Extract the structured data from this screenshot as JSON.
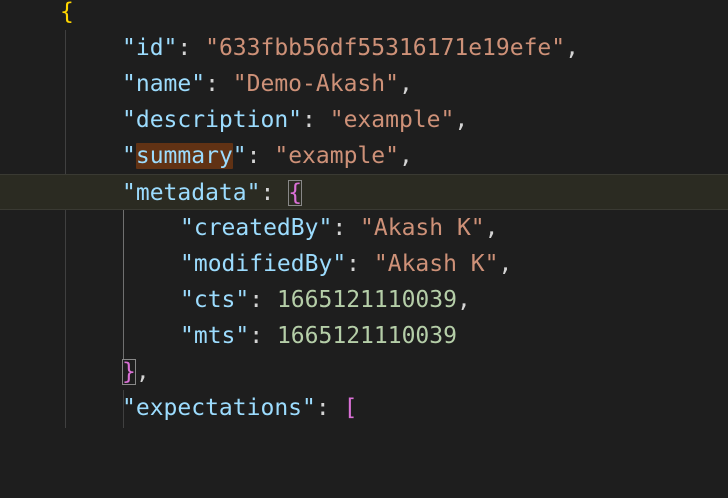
{
  "editor": {
    "lines": [
      {
        "open_brace": "{"
      },
      {
        "key": "\"id\"",
        "colon": ": ",
        "value": "\"633fbb56df55316171e19efe\"",
        "comma": ","
      },
      {
        "key": "\"name\"",
        "colon": ": ",
        "value": "\"Demo-Akash\"",
        "comma": ","
      },
      {
        "key": "\"description\"",
        "colon": ": ",
        "value": "\"example\"",
        "comma": ","
      },
      {
        "q1": "\"",
        "key_word": "summary",
        "q2": "\"",
        "colon": ": ",
        "value": "\"example\"",
        "comma": ","
      },
      {
        "key": "\"metadata\"",
        "colon": ": ",
        "open_brace": "{"
      },
      {
        "key": "\"createdBy\"",
        "colon": ": ",
        "value": "\"Akash K\"",
        "comma": ","
      },
      {
        "key": "\"modifiedBy\"",
        "colon": ": ",
        "value": "\"Akash K\"",
        "comma": ","
      },
      {
        "key": "\"cts\"",
        "colon": ": ",
        "value": "1665121110039",
        "comma": ","
      },
      {
        "key": "\"mts\"",
        "colon": ": ",
        "value": "1665121110039"
      },
      {
        "close_brace": "}",
        "comma": ","
      },
      {
        "key": "\"expectations\"",
        "colon": ": ",
        "open_bracket": "["
      }
    ]
  },
  "colors": {
    "background": "#1e1e1e",
    "key": "#9cdcfe",
    "string": "#ce9178",
    "number": "#b5cea8",
    "punctuation": "#d4d4d4",
    "bracket_level1": "#ffd700",
    "bracket_level2": "#da70d6",
    "word_highlight": "#613214"
  }
}
